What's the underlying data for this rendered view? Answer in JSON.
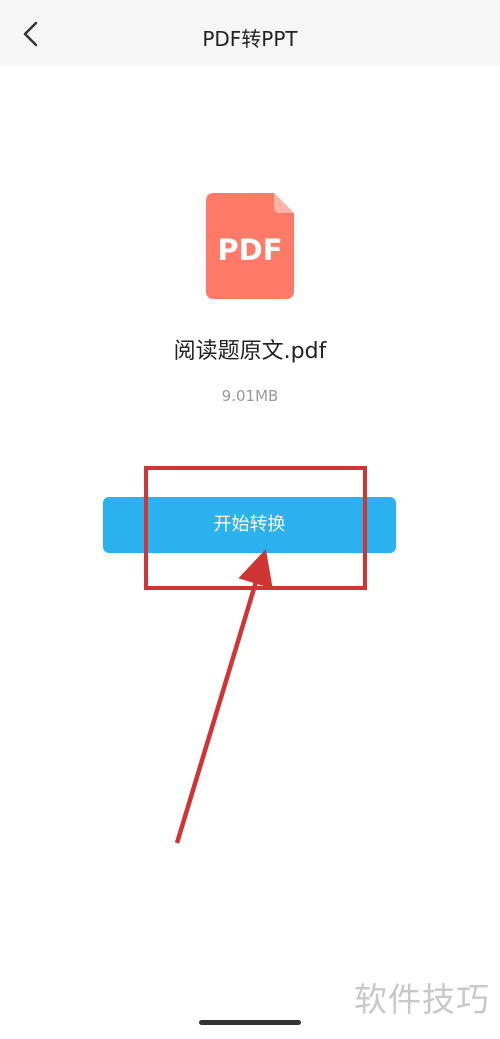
{
  "header": {
    "title": "PDF转PPT",
    "back_icon": "chevron-left-icon",
    "background_color": "#f6f6f6"
  },
  "file": {
    "icon_label": "PDF",
    "icon_color": "#ff7a67",
    "name": "阅读题原文.pdf",
    "size": "9.01MB"
  },
  "action": {
    "start_label": "开始转换",
    "button_color": "#2bb2ee"
  },
  "annotation": {
    "highlight_color": "#d03434"
  },
  "watermark": {
    "text": "软件技巧"
  }
}
